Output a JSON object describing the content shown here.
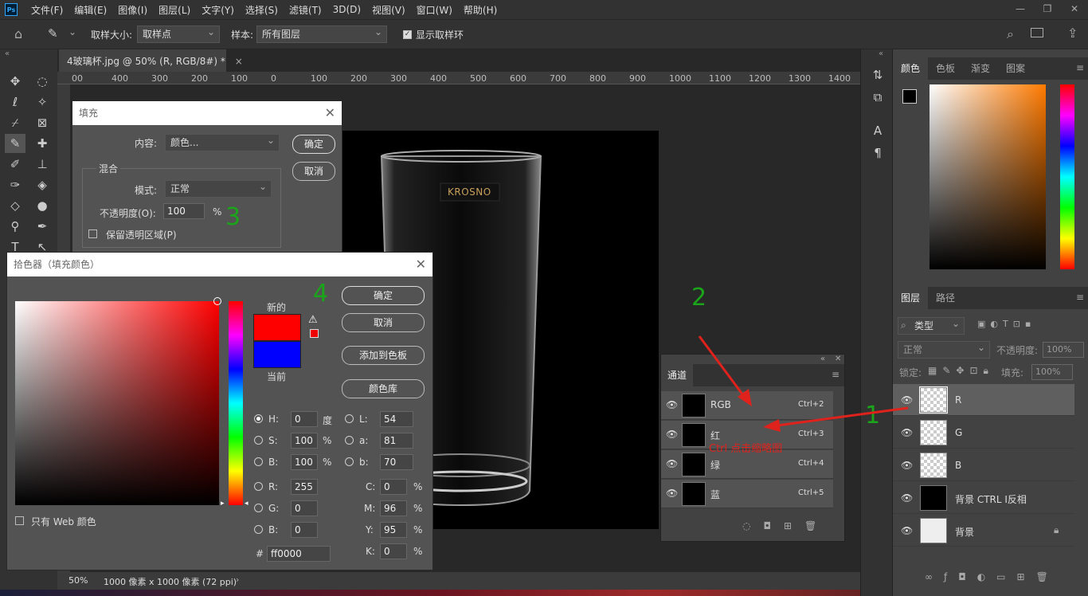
{
  "menubar": {
    "logo": "Ps",
    "items": [
      "文件(F)",
      "编辑(E)",
      "图像(I)",
      "图层(L)",
      "文字(Y)",
      "选择(S)",
      "滤镜(T)",
      "3D(D)",
      "视图(V)",
      "窗口(W)",
      "帮助(H)"
    ],
    "window_controls": [
      "—",
      "❐",
      "✕"
    ]
  },
  "options": {
    "sample_size_label": "取样大小:",
    "sample_size_value": "取样点",
    "sample_label": "样本:",
    "sample_value": "所有图层",
    "show_ring_label": "显示取样环"
  },
  "document": {
    "tab_title": "4玻璃杯.jpg @ 50% (R, RGB/8#) *",
    "tab_close": "×",
    "ruler_ticks": [
      "00",
      "400",
      "300",
      "200",
      "100",
      "0",
      "100",
      "200",
      "300",
      "400",
      "500",
      "600",
      "700",
      "800",
      "900",
      "1000",
      "1100",
      "1200",
      "1300",
      "1400"
    ],
    "brand": "KROSNO"
  },
  "status": {
    "zoom": "50%",
    "info": "1000 像素 x 1000 像素 (72 ppi)",
    "arrow": "›"
  },
  "fill_dialog": {
    "title": "填充",
    "content_label": "内容:",
    "content_value": "颜色...",
    "ok": "确定",
    "cancel": "取消",
    "blend_label": "混合",
    "mode_label": "模式:",
    "mode_value": "正常",
    "opacity_label": "不透明度(O):",
    "opacity_value": "100",
    "opacity_unit": "%",
    "preserve_label": "保留透明区域(P)",
    "step_marker": "3"
  },
  "picker_dialog": {
    "title": "拾色器（填充颜色）",
    "new_label": "新的",
    "current_label": "当前",
    "new_color": "#ff0000",
    "current_color": "#0000ff",
    "ok": "确定",
    "cancel": "取消",
    "add_swatch": "添加到色板",
    "library": "颜色库",
    "web_only": "只有 Web 颜色",
    "step_marker": "4",
    "h_label": "H:",
    "h_value": "0",
    "h_unit": "度",
    "s_label": "S:",
    "s_value": "100",
    "s_unit": "%",
    "b_label": "B:",
    "b_value": "100",
    "b_unit": "%",
    "r_label": "R:",
    "r_value": "255",
    "g_label": "G:",
    "g_value": "0",
    "bb_label": "B:",
    "bb_value": "0",
    "l_label": "L:",
    "l_value": "54",
    "a_label": "a:",
    "a_value": "81",
    "lb_label": "b:",
    "lb_value": "70",
    "c_label": "C:",
    "c_value": "0",
    "m_label": "M:",
    "m_value": "96",
    "y_label": "Y:",
    "y_value": "95",
    "k_label": "K:",
    "k_value": "0",
    "pct": "%",
    "hex_label": "#",
    "hex_value": "ff0000"
  },
  "channels": {
    "tab": "通道",
    "rows": [
      {
        "name": "RGB",
        "shortcut": "Ctrl+2"
      },
      {
        "name": "红",
        "shortcut": "Ctrl+3"
      },
      {
        "name": "绿",
        "shortcut": "Ctrl+4"
      },
      {
        "name": "蓝",
        "shortcut": "Ctrl+5"
      }
    ],
    "annotation": "Ctrl 点击缩略图",
    "step_marker": "2"
  },
  "color_panel": {
    "tabs": [
      "颜色",
      "色板",
      "渐变",
      "图案"
    ],
    "hue_color": "#ff7a00"
  },
  "layers_panel": {
    "tabs": [
      "图层",
      "路径"
    ],
    "filter_label": "类型",
    "blend_mode": "正常",
    "opacity_label": "不透明度:",
    "opacity_value": "100%",
    "lock_label": "锁定:",
    "fill_label": "填充:",
    "fill_value": "100%",
    "layers": [
      {
        "name": "R"
      },
      {
        "name": "G"
      },
      {
        "name": "B"
      },
      {
        "name": "背景 CTRL I反相"
      },
      {
        "name": "背景"
      }
    ],
    "step_marker": "1"
  }
}
